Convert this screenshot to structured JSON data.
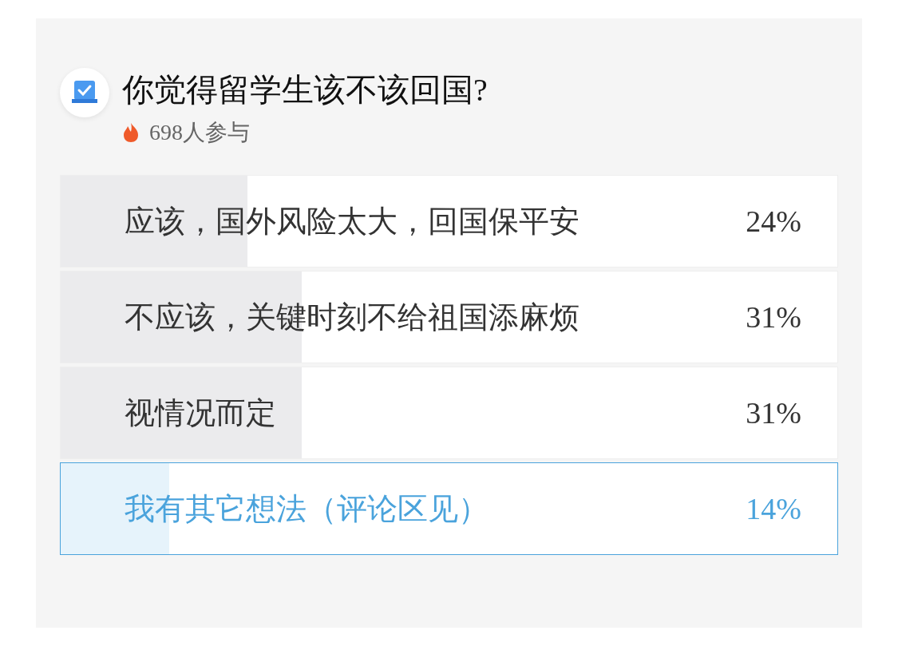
{
  "poll": {
    "title": "你觉得留学生该不该回国?",
    "participants": "698人参与",
    "options": [
      {
        "label": "应该，国外风险太大，回国保平安",
        "percent": "24%",
        "level": 0.24,
        "selected": false
      },
      {
        "label": "不应该，关键时刻不给祖国添麻烦",
        "percent": "31%",
        "level": 0.31,
        "selected": false
      },
      {
        "label": "视情况而定",
        "percent": "31%",
        "level": 0.31,
        "selected": false
      },
      {
        "label": "我有其它想法（评论区见）",
        "percent": "14%",
        "level": 0.14,
        "selected": true
      }
    ]
  }
}
